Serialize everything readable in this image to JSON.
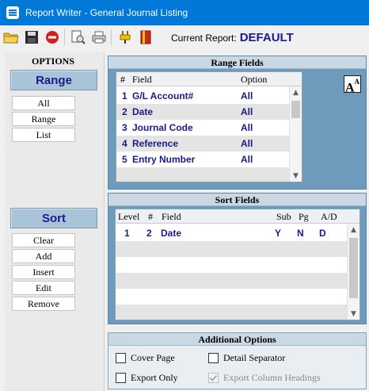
{
  "window": {
    "title": "Report Writer - General Journal Listing"
  },
  "toolbar": {
    "buttons": [
      {
        "icon": "open-folder-icon"
      },
      {
        "icon": "save-disk-icon"
      },
      {
        "icon": "delete-icon"
      },
      {
        "icon": "print-preview-icon"
      },
      {
        "icon": "printer-icon"
      },
      {
        "icon": "plug-icon"
      },
      {
        "icon": "book-icon"
      }
    ],
    "current_report_label": "Current Report:",
    "current_report_value": "DEFAULT"
  },
  "options": {
    "title": "OPTIONS",
    "range_label": "Range",
    "range_buttons": [
      "All",
      "Range",
      "List"
    ],
    "sort_label": "Sort",
    "sort_buttons": [
      "Clear",
      "Add",
      "Insert",
      "Edit",
      "Remove"
    ]
  },
  "range_fields": {
    "title": "Range  Fields",
    "columns": [
      "#",
      "Field",
      "Option"
    ],
    "rows": [
      {
        "num": "1",
        "field": "G/L Account#",
        "option": "All"
      },
      {
        "num": "2",
        "field": "Date",
        "option": "All"
      },
      {
        "num": "3",
        "field": "Journal Code",
        "option": "All"
      },
      {
        "num": "4",
        "field": "Reference",
        "option": "All"
      },
      {
        "num": "5",
        "field": "Entry Number",
        "option": "All"
      }
    ],
    "font_button": "A"
  },
  "sort_fields": {
    "title": "Sort Fields",
    "columns": [
      "Level",
      "#",
      "Field",
      "Sub",
      "Pg",
      "A/D"
    ],
    "rows": [
      {
        "level": "1",
        "num": "2",
        "field": "Date",
        "sub": "Y",
        "pg": "N",
        "ad": "D"
      }
    ]
  },
  "additional_options": {
    "title": "Additional Options",
    "cover_page": "Cover Page",
    "detail_separator": "Detail Separator",
    "export_only": "Export Only",
    "export_column_headings": "Export Column Headings"
  }
}
